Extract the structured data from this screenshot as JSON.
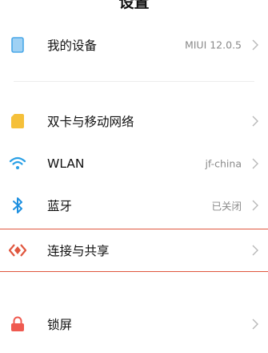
{
  "header": {
    "title": "设置"
  },
  "items": [
    {
      "label": "我的设备",
      "value": "MIUI 12.0.5",
      "icon": "device-icon"
    },
    {
      "label": "双卡与移动网络",
      "value": "",
      "icon": "sim-card-icon"
    },
    {
      "label": "WLAN",
      "value": "jf-china",
      "icon": "wifi-icon"
    },
    {
      "label": "蓝牙",
      "value": "已关闭",
      "icon": "bluetooth-icon"
    },
    {
      "label": "连接与共享",
      "value": "",
      "icon": "connection-sharing-icon"
    },
    {
      "label": "锁屏",
      "value": "",
      "icon": "lock-icon"
    }
  ],
  "colors": {
    "device": "#4aa8e8",
    "sim": "#f5c03a",
    "wifi": "#2aa0e6",
    "bluetooth": "#1e90e0",
    "connection": "#e0573f",
    "lock": "#ef5a50",
    "highlight": "#e0573f"
  }
}
